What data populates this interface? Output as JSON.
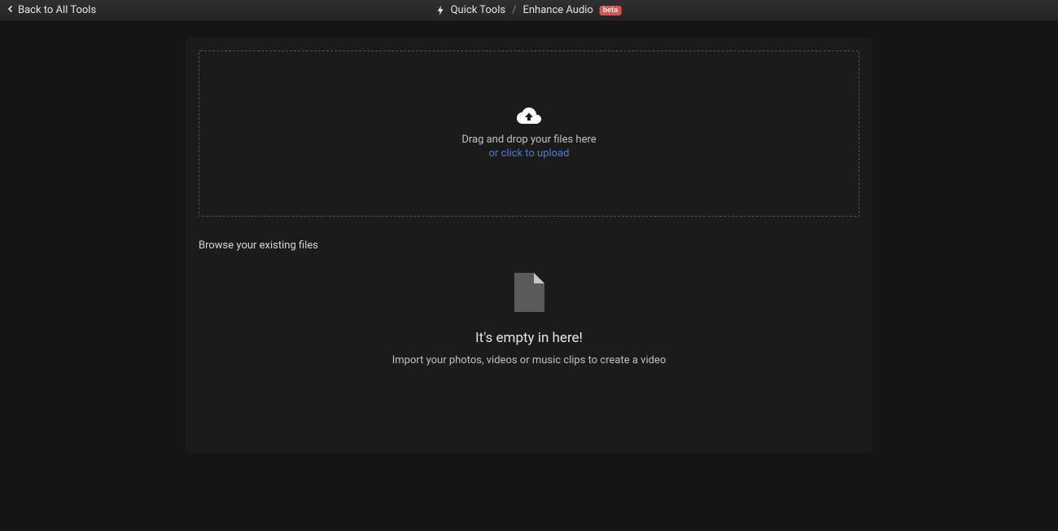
{
  "header": {
    "back_label": "Back to All Tools",
    "breadcrumb_root": "Quick Tools",
    "breadcrumb_current": "Enhance Audio",
    "beta_label": "beta"
  },
  "drop_zone": {
    "drag_text": "Drag and drop your files here",
    "click_text": "or click to upload"
  },
  "browse": {
    "title": "Browse your existing files"
  },
  "empty_state": {
    "title": "It's empty in here!",
    "subtitle": "Import your photos, videos or music clips to create a video"
  }
}
